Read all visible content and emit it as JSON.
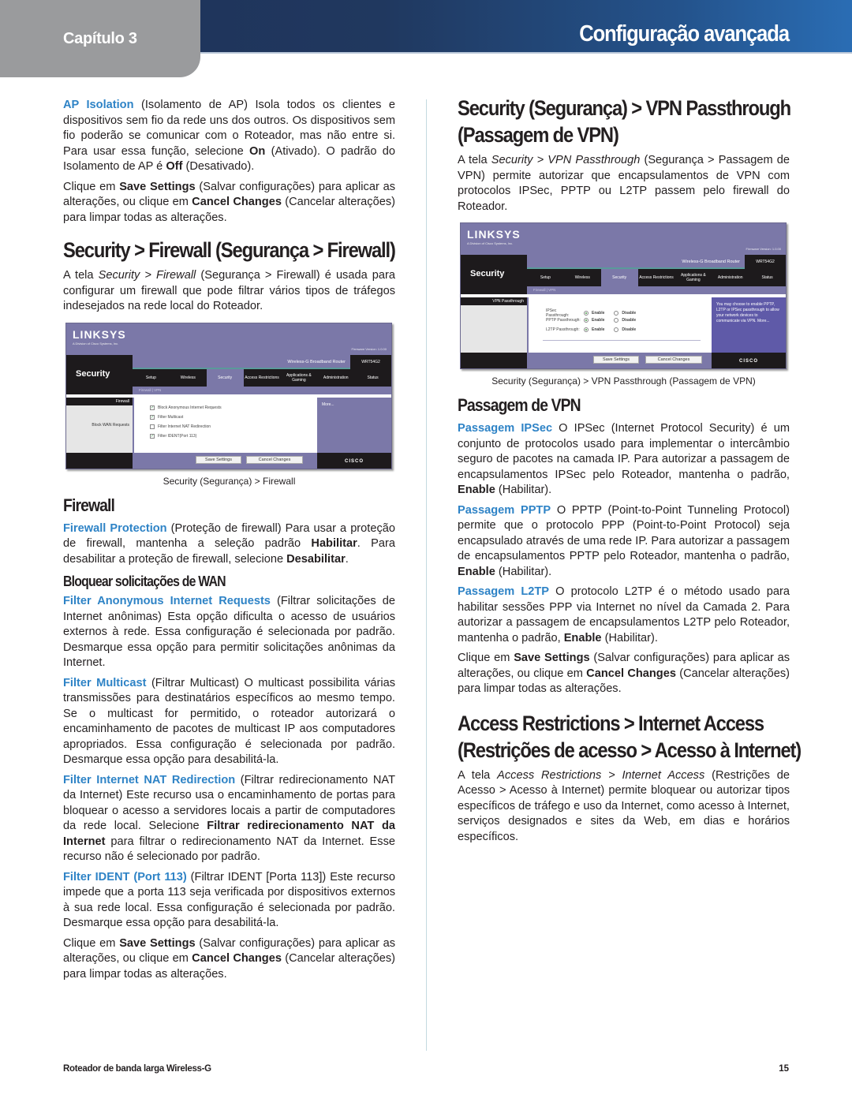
{
  "header": {
    "chapter": "Capítulo 3",
    "title": "Configuração avançada"
  },
  "left": {
    "ap_isolation": {
      "term": "AP Isolation",
      "text_a": " (Isolamento de AP) Isola todos os clientes e dispositivos sem fio da rede uns dos outros. Os dispositivos sem fio poderão se comunicar com o Roteador, mas não entre si. Para usar essa função, selecione ",
      "bold_on": "On",
      "text_b": " (Ativado). O padrão do Isolamento de AP é ",
      "bold_off": "Off",
      "text_c": " (Desativado)."
    },
    "save1": {
      "text_a": "Clique em ",
      "save": "Save Settings",
      "text_b": " (Salvar configurações) para aplicar as alterações, ou clique em ",
      "cancel": "Cancel Changes",
      "text_c": " (Cancelar alterações) para limpar todas as alterações."
    },
    "firewall_section": {
      "heading": "Security > Firewall (Segurança > Firewall)",
      "intro_a": "A tela ",
      "intro_italic": "Security > Firewall",
      "intro_b": " (Segurança > Firewall) é usada para configurar um firewall que pode filtrar vários tipos de tráfegos indesejados na rede local do Roteador.",
      "caption": "Security (Segurança) > Firewall"
    },
    "firewall_shot": {
      "logo": "LINKSYS",
      "logo_sub": "A Division of Cisco Systems, Inc.",
      "firmware": "Firmware Version: 1.0.00",
      "section": "Security",
      "product": "Wireless-G Broadband Router",
      "model": "WRT54G2",
      "tabs": [
        "Setup",
        "Wireless",
        "Security",
        "Access Restrictions",
        "Applications & Gaming",
        "Administration",
        "Status"
      ],
      "subtabs": "Firewall   |   VPN",
      "sidebar_label": "Firewall",
      "sidebar_item": "Block WAN Requests",
      "options": [
        {
          "label": "Block Anonymous Internet Requests",
          "checked": true
        },
        {
          "label": "Filter Multicast",
          "checked": true
        },
        {
          "label": "Filter Internet NAT Redirection",
          "checked": false
        },
        {
          "label": "Filter IDENT(Port 113)",
          "checked": true
        }
      ],
      "help": "More...",
      "save_btn": "Save Settings",
      "cancel_btn": "Cancel Changes",
      "brand": "CISCO"
    },
    "firewall_sub": {
      "heading": "Firewall",
      "term": "Firewall Protection",
      "text_a": " (Proteção de firewall) Para usar a proteção de firewall, mantenha a seleção padrão ",
      "bold_a": "Habilitar",
      "text_b": ". Para desabilitar a proteção de firewall, selecione ",
      "bold_b": "Desabilitar",
      "text_c": "."
    },
    "block_wan": {
      "heading": "Bloquear solicitações de WAN",
      "anon_term": "Filter Anonymous Internet Requests",
      "anon_text": "  (Filtrar solicitações de Internet anônimas) Esta opção dificulta o acesso de usuários externos à rede. Essa configuração é selecionada por padrão. Desmarque essa opção para permitir solicitações anônimas da Internet.",
      "mc_term": "Filter Multicast",
      "mc_text": " (Filtrar Multicast) O multicast possibilita várias transmissões para destinatários específicos ao mesmo tempo. Se o multicast for permitido, o roteador autorizará o encaminhamento de pacotes de multicast IP aos computadores apropriados. Essa configuração é selecionada por padrão. Desmarque essa opção para desabilitá-la.",
      "nat_term": "Filter Internet NAT Redirection",
      "nat_text_a": " (Filtrar redirecionamento NAT da Internet) Este recurso usa o encaminhamento de portas para bloquear o acesso a servidores locais a partir de computadores da rede local. Selecione ",
      "nat_bold": "Filtrar redirecionamento NAT da Internet",
      "nat_text_b": " para filtrar o redirecionamento NAT da Internet. Esse recurso não é selecionado por padrão.",
      "ident_term": "Filter IDENT (Port 113)",
      "ident_text": " (Filtrar IDENT [Porta 113]) Este recurso impede que a porta 113 seja verificada por dispositivos externos à sua rede local. Essa configuração é selecionada por padrão. Desmarque essa opção para desabilitá-la."
    },
    "save2": {
      "text_a": "Clique em ",
      "save": "Save Settings",
      "text_b": " (Salvar configurações) para aplicar as alterações, ou clique em ",
      "cancel": "Cancel Changes",
      "text_c": " (Cancelar alterações) para limpar todas as alterações."
    }
  },
  "right": {
    "vpn_section": {
      "heading_line1": "Security (Segurança) > VPN Passthrough",
      "heading_line2": "(Passagem de VPN)",
      "intro_a": "A tela ",
      "intro_italic": "Security > VPN Passthrough",
      "intro_b": " (Segurança > Passagem de VPN) permite autorizar que encapsulamentos de VPN com protocolos IPSec, PPTP ou L2TP passem pelo firewall do Roteador.",
      "caption": "Security (Segurança) > VPN Passthrough (Passagem de VPN)"
    },
    "vpn_shot": {
      "logo": "LINKSYS",
      "logo_sub": "A Division of Cisco Systems, Inc.",
      "firmware": "Firmware Version: 1.0.00",
      "section": "Security",
      "product": "Wireless-G Broadband Router",
      "model": "WRT54G2",
      "tabs": [
        "Setup",
        "Wireless",
        "Security",
        "Access Restrictions",
        "Applications & Gaming",
        "Administration",
        "Status"
      ],
      "subtabs": "Firewall   |   VPN",
      "sidebar_label": "VPN Passthrough",
      "rows": [
        {
          "label": "IPSec Passthrough:",
          "enable": "Enable",
          "disable": "Disable",
          "selected": "Enable"
        },
        {
          "label": "PPTP Passthrough:",
          "enable": "Enable",
          "disable": "Disable",
          "selected": "Enable"
        },
        {
          "label": "L2TP Passthrough:",
          "enable": "Enable",
          "disable": "Disable",
          "selected": "Enable"
        }
      ],
      "help": "You may choose to enable PPTP, L2TP or IPSec passthrough to allow your network devices to communicate via VPN. More...",
      "save_btn": "Save Settings",
      "cancel_btn": "Cancel Changes",
      "brand": "CISCO"
    },
    "vpn_sub": {
      "heading": "Passagem de VPN",
      "ipsec_term": "Passagem IPSec",
      "ipsec_text": " O IPSec (Internet Protocol Security) é um conjunto de protocolos usado para implementar o intercâmbio seguro de pacotes na camada IP. Para autorizar a passagem de encapsulamentos IPSec pelo Roteador, mantenha o padrão, ",
      "ipsec_bold": "Enable",
      "ipsec_end": " (Habilitar).",
      "pptp_term": "Passagem PPTP",
      "pptp_text": "  O PPTP (Point-to-Point Tunneling Protocol) permite que o protocolo PPP (Point-to-Point Protocol) seja encapsulado através de uma rede IP. Para autorizar a passagem de encapsulamentos PPTP pelo Roteador, mantenha o padrão, ",
      "pptp_bold": "Enable",
      "pptp_end": " (Habilitar).",
      "l2tp_term": "Passagem L2TP",
      "l2tp_text": "  O protocolo L2TP é o método usado para habilitar sessões PPP via Internet no nível da Camada 2. Para autorizar a passagem de encapsulamentos L2TP pelo Roteador, mantenha o padrão, ",
      "l2tp_bold": "Enable",
      "l2tp_end": " (Habilitar)."
    },
    "save3": {
      "text_a": "Clique em ",
      "save": "Save Settings",
      "text_b": " (Salvar configurações) para aplicar as alterações, ou clique em ",
      "cancel": "Cancel Changes",
      "text_c": " (Cancelar alterações) para limpar todas as alterações."
    },
    "access_section": {
      "heading_line1": "Access Restrictions > Internet Access",
      "heading_line2": "(Restrições de acesso > Acesso à Internet)",
      "intro_a": "A tela ",
      "intro_italic": "Access Restrictions > Internet Access",
      "intro_b": " (Restrições de Acesso > Acesso à Internet) permite bloquear ou autorizar tipos específicos de tráfego e uso da Internet, como acesso à Internet, serviços designados e sites da Web, em dias e horários específicos."
    }
  },
  "footer": {
    "product": "Roteador de banda larga Wireless-G",
    "page": "15"
  }
}
